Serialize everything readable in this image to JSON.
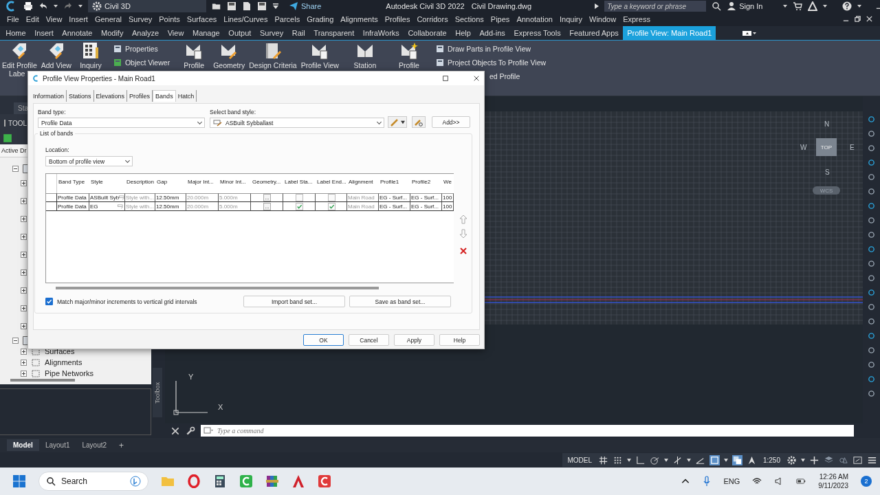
{
  "title_bar": {
    "workspace": "Civil 3D",
    "share": "Share",
    "app_title": "Autodesk Civil 3D 2022",
    "file_name": "Civil Drawing.dwg",
    "search": {
      "placeholder": "Type a keyword or phrase"
    },
    "sign_in": "Sign In"
  },
  "menu_bar": [
    "File",
    "Edit",
    "View",
    "Insert",
    "General",
    "Survey",
    "Points",
    "Surfaces",
    "Lines/Curves",
    "Parcels",
    "Grading",
    "Alignments",
    "Profiles",
    "Corridors",
    "Sections",
    "Pipes",
    "Annotation",
    "Inquiry",
    "Window",
    "Express"
  ],
  "ribbon_tabs": [
    {
      "label": "Home",
      "selected": false
    },
    {
      "label": "Insert",
      "selected": false
    },
    {
      "label": "Annotate",
      "selected": false
    },
    {
      "label": "Modify",
      "selected": false
    },
    {
      "label": "Analyze",
      "selected": false
    },
    {
      "label": "View",
      "selected": false
    },
    {
      "label": "Manage",
      "selected": false
    },
    {
      "label": "Output",
      "selected": false
    },
    {
      "label": "Survey",
      "selected": false
    },
    {
      "label": "Rail",
      "selected": false
    },
    {
      "label": "Transparent",
      "selected": false
    },
    {
      "label": "InfraWorks",
      "selected": false
    },
    {
      "label": "Collaborate",
      "selected": false
    },
    {
      "label": "Help",
      "selected": false
    },
    {
      "label": "Add-ins",
      "selected": false
    },
    {
      "label": "Express Tools",
      "selected": false
    },
    {
      "label": "Featured Apps",
      "selected": false
    },
    {
      "label": "Profile View: Main Road1",
      "selected": true
    }
  ],
  "ribbon": [
    {
      "kind": "large",
      "lines": [
        "Edit Profile",
        "Labe"
      ]
    },
    {
      "kind": "large",
      "lines": [
        "Add View"
      ]
    },
    {
      "kind": "large",
      "lines": [
        "Inquiry"
      ]
    },
    {
      "kind": "stack",
      "items": [
        "Properties",
        "Object Viewer"
      ]
    },
    {
      "kind": "large",
      "lines": [
        "Profile"
      ]
    },
    {
      "kind": "large",
      "lines": [
        "Geometry"
      ]
    },
    {
      "kind": "large",
      "lines": [
        "Design Criteria"
      ]
    },
    {
      "kind": "large",
      "lines": [
        "Profile View"
      ]
    },
    {
      "kind": "large",
      "lines": [
        "Station"
      ]
    },
    {
      "kind": "large",
      "lines": [
        "Profile"
      ]
    },
    {
      "kind": "stack",
      "items": [
        "Draw Parts in Profile View",
        "Project Objects To Profile View",
        "ed Profile"
      ]
    }
  ],
  "toolspace": {
    "tab": "Sta",
    "header": "TOOL",
    "view_tab": "Active Dr",
    "tree": [
      {
        "expanded": true,
        "children": [
          {
            "expanded": false
          },
          {
            "expanded": false
          },
          {
            "expanded": false
          },
          {
            "expanded": false
          },
          {
            "expanded": false
          },
          {
            "expanded": false
          },
          {
            "expanded": false
          },
          {
            "expanded": false
          },
          {
            "expanded": false
          }
        ]
      },
      {
        "expanded": true,
        "children": [
          {
            "label": "Surfaces",
            "expanded": false
          },
          {
            "label": "Alignments",
            "expanded": false
          },
          {
            "label": "Pipe Networks",
            "expanded": false
          }
        ]
      }
    ]
  },
  "toolbox": "Toolbox",
  "viewcube": {
    "north": "N",
    "south": "S",
    "east": "E",
    "west": "W",
    "face": "TOP",
    "ucs": "WCS"
  },
  "ucs_icon": {
    "y": "Y",
    "x": "X"
  },
  "command_line": {
    "placeholder": "Type a command"
  },
  "layout_tabs": [
    {
      "label": "Model",
      "selected": true
    },
    {
      "label": "Layout1",
      "selected": false
    },
    {
      "label": "Layout2",
      "selected": false
    }
  ],
  "new_layout": "+",
  "status_bar": [
    {
      "kind": "label",
      "label": "MODEL"
    },
    {
      "kind": "grid",
      "on": false
    },
    {
      "kind": "snap",
      "on": false
    },
    {
      "kind": "caret"
    },
    {
      "kind": "ortho",
      "on": false
    },
    {
      "kind": "polar",
      "on": false
    },
    {
      "kind": "caret"
    },
    {
      "kind": "iso",
      "on": false
    },
    {
      "kind": "caret"
    },
    {
      "kind": "osnap",
      "on": false
    },
    {
      "kind": "object",
      "on": true
    },
    {
      "kind": "caret"
    },
    {
      "kind": "transparency",
      "on": true
    },
    {
      "kind": "annotation",
      "on": false
    },
    {
      "kind": "scale",
      "label": "1:250"
    },
    {
      "kind": "gear"
    },
    {
      "kind": "caret"
    },
    {
      "kind": "plus"
    },
    {
      "kind": "hardware",
      "on": false
    },
    {
      "kind": "isolate",
      "on": false
    },
    {
      "kind": "fullscreen"
    },
    {
      "kind": "menu"
    }
  ],
  "dialog": {
    "title": "Profile View Properties - Main Road1",
    "tabs": [
      {
        "label": "Information",
        "selected": false
      },
      {
        "label": "Stations",
        "selected": false
      },
      {
        "label": "Elevations",
        "selected": false
      },
      {
        "label": "Profiles",
        "selected": false
      },
      {
        "label": "Bands",
        "selected": true
      },
      {
        "label": "Hatch",
        "selected": false
      }
    ],
    "band_type": {
      "label": "Band type:",
      "value": "Profile Data"
    },
    "band_style": {
      "label": "Select band style:",
      "value": "ASBuilt Sybballast"
    },
    "add_button": "Add>>",
    "group_title": "List of bands",
    "location": {
      "label": "Location:",
      "value": "Bottom of profile view"
    },
    "columns": [
      "Band Type",
      "Style",
      "Description",
      "Gap",
      "Major Int...",
      "Minor Int...",
      "Geometry...",
      "Label Sta...",
      "Label End...",
      "Alignment",
      "Profile1",
      "Profile2",
      "We"
    ],
    "rows": [
      {
        "band_type": "Profile Data",
        "style": "ASBuilt Syb",
        "description": "Style with...",
        "gap": "12.50mm",
        "major": "20.000m",
        "minor": "5.000m",
        "geometry": "...",
        "label_start": false,
        "label_end": false,
        "alignment": "Main Road",
        "profile1": "EG - Surf...",
        "profile2": "EG - Surf...",
        "we": "100"
      },
      {
        "band_type": "Profile Data",
        "style": "EG",
        "description": "Style with...",
        "gap": "12.50mm",
        "major": "20.000m",
        "minor": "5.000m",
        "geometry": "...",
        "label_start": true,
        "label_end": true,
        "alignment": "Main Road",
        "profile1": "EG - Surf...",
        "profile2": "EG - Surf...",
        "we": "100"
      }
    ],
    "match": {
      "label": "Match major/minor increments to vertical grid intervals",
      "checked": true
    },
    "import_button": "Import band set...",
    "save_button": "Save as band set...",
    "buttons": [
      {
        "label": "OK",
        "default": true
      },
      {
        "label": "Cancel",
        "default": false
      },
      {
        "label": "Apply",
        "default": false
      },
      {
        "label": "Help",
        "default": false
      }
    ]
  },
  "taskbar": {
    "search": "Search",
    "language": "ENG",
    "time": "12:26 AM",
    "date": "9/11/2023",
    "notifications": "2"
  }
}
